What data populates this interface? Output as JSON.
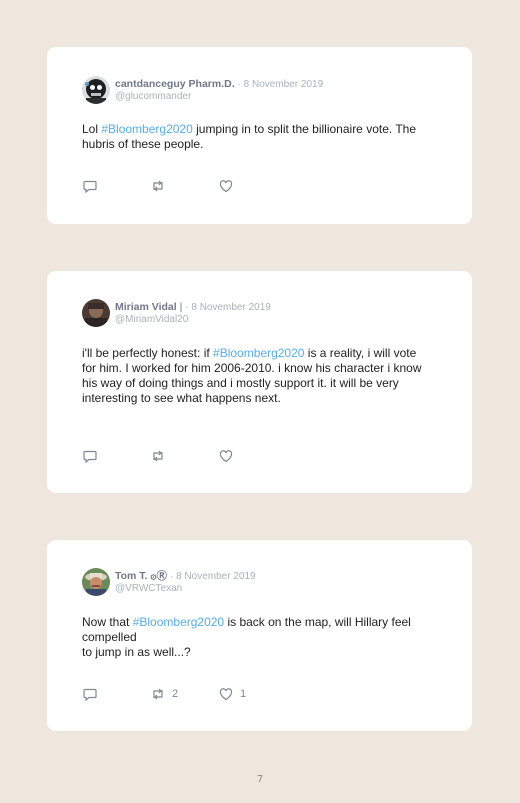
{
  "tweets": [
    {
      "display_name": "cantdanceguy Pharm.D.",
      "date": "· 8 November 2019",
      "handle": "@glucommander",
      "text_before": "Lol ",
      "hashtag": "#Bloomberg2020",
      "text_after": " jumping in to split the billionaire vote. The hubris of these people.",
      "retweet_count": "",
      "like_count": ""
    },
    {
      "display_name": "Miriam Vidal",
      "name_suffix": " |",
      "date": "· 8 November 2019",
      "handle": "@MiriamVidal20",
      "text_before": "i'll be perfectly honest: if ",
      "hashtag": "#Bloomberg2020",
      "text_after": " is a reality, i will vote for him. I worked for him 2006-2010. i know his character i know his way of doing things and i mostly support it. it will be very interesting to see what happens next.",
      "retweet_count": "",
      "like_count": ""
    },
    {
      "display_name": "Tom T. ۞Ⓡ",
      "date": "· 8 November 2019",
      "handle": "@VRWCTexan",
      "text_before": "Now that ",
      "hashtag": "#Bloomberg2020",
      "text_after": " is back on the map, will Hillary feel compelled",
      "text_line2": "to jump in as well...?",
      "retweet_count": "2",
      "like_count": "1"
    }
  ],
  "icons": {
    "reply": "reply-icon",
    "retweet": "retweet-icon",
    "like": "heart-icon"
  },
  "colors": {
    "background": "#efe7dd",
    "card": "#ffffff",
    "hashtag": "#55acee",
    "name": "#6f7886",
    "muted": "#aab2b8"
  },
  "page_number": "7"
}
